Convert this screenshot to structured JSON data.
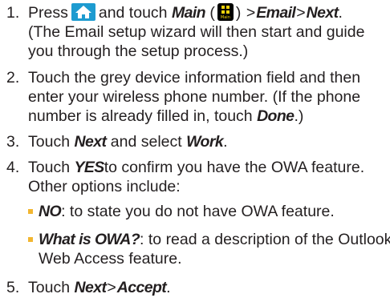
{
  "steps": [
    {
      "number": "1.",
      "lines": [
        {
          "pre": "Press",
          "mid": "and touch",
          "em1": "Main",
          "paren_open": "(",
          "paren_close": ")",
          "em2": "Email",
          "em3": "Next",
          "end": "."
        },
        {
          "text": "(The Email setup wizard will then start and guide"
        },
        {
          "text": "you through the setup process.)"
        }
      ]
    },
    {
      "number": "2.",
      "lines": [
        {
          "text": "Touch the grey device information field and then"
        },
        {
          "text": "enter your wireless phone number. (If the phone"
        },
        {
          "pre": "number is already filled in, touch",
          "em": "Done",
          "post": ".)"
        }
      ]
    },
    {
      "number": "3.",
      "lines": [
        {
          "pre": "Touch",
          "em1": "Next",
          "mid": "and select",
          "em2": "Work",
          "post": "."
        }
      ]
    },
    {
      "number": "4.",
      "lines": [
        {
          "pre": "Touch",
          "em": "YES",
          "post": "to confirm you have the OWA feature."
        },
        {
          "text": "Other options include:"
        }
      ],
      "bullets": [
        {
          "em": "NO",
          "lines": [
            ": to state you do not have OWA feature."
          ]
        },
        {
          "em": "What is OWA?",
          "lines": [
            ": to read a description of the Outlook",
            "Web Access feature."
          ]
        }
      ]
    },
    {
      "number": "5.",
      "lines": [
        {
          "pre": "Touch",
          "em1": "Next",
          "em2": "Accept",
          "post": "."
        }
      ]
    }
  ],
  "separator": ">",
  "icons": {
    "home": "home-icon",
    "main": "main-menu-icon",
    "main_icon_label": "Main"
  },
  "colors": {
    "text": "#231f20",
    "home_icon_bg": "#1d9bd0",
    "main_icon_bg": "#000000",
    "main_icon_fg": "#f5d20b",
    "bullet": "#f2b630"
  }
}
